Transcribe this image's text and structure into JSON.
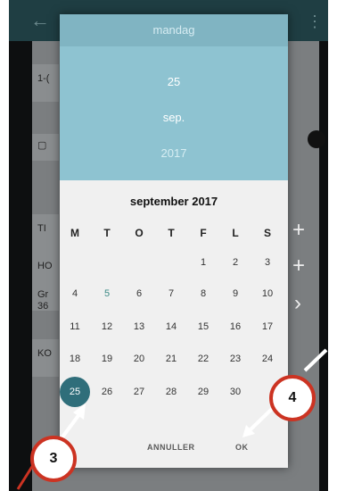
{
  "dialog": {
    "header": {
      "weekday": "mandag",
      "day": "25",
      "month": "sep.",
      "year": "2017"
    },
    "month_title": "september 2017",
    "weekday_labels": [
      "M",
      "T",
      "O",
      "T",
      "F",
      "L",
      "S"
    ],
    "days": [
      "1",
      "2",
      "3",
      "4",
      "5",
      "6",
      "7",
      "8",
      "9",
      "10",
      "11",
      "12",
      "13",
      "14",
      "15",
      "16",
      "17",
      "18",
      "19",
      "20",
      "21",
      "22",
      "23",
      "24",
      "25",
      "26",
      "27",
      "28",
      "29",
      "30"
    ],
    "today": "5",
    "selected_day": "25",
    "buttons": {
      "cancel": "ANNULLER",
      "ok": "OK"
    }
  },
  "background_app": {
    "field_label_1": "1-(",
    "label_ti": "TI",
    "label_ho": "HO",
    "label_gr": "Gr",
    "label_36": "36",
    "label_ko": "KO"
  },
  "annotations": {
    "step_left": "3",
    "step_right": "4",
    "color": "#cc3322"
  }
}
